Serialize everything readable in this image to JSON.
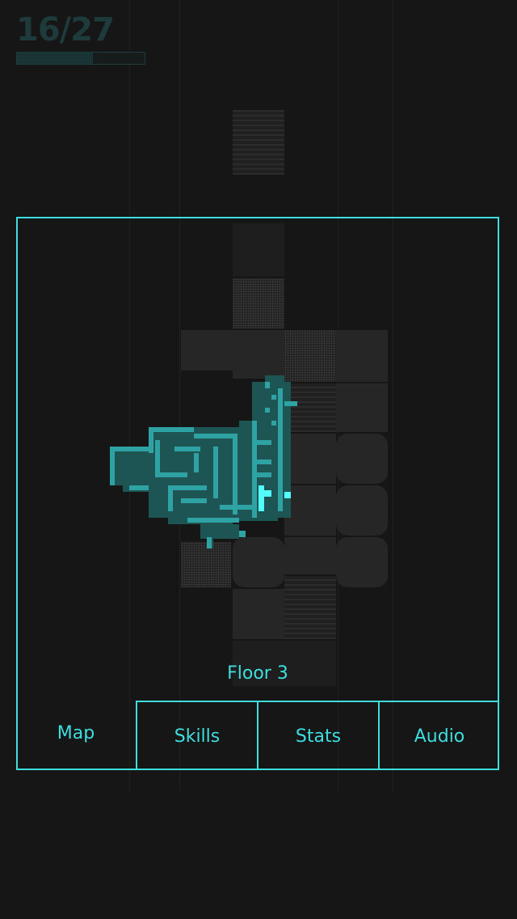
{
  "hud": {
    "progress_text": "16/27",
    "progress_fraction": 0.5926
  },
  "map": {
    "floor_label": "Floor 3"
  },
  "tabs": [
    {
      "label": "Map",
      "active": true
    },
    {
      "label": "Skills",
      "active": false
    },
    {
      "label": "Stats",
      "active": false
    },
    {
      "label": "Audio",
      "active": false
    }
  ],
  "colors": {
    "accent": "#3fdede",
    "explored_fill": "#1d5555",
    "explored_edge": "#2fa3a3",
    "player": "#54ffff",
    "background": "#161616"
  },
  "icons": {
    "player_marker": "player-marker-icon"
  }
}
